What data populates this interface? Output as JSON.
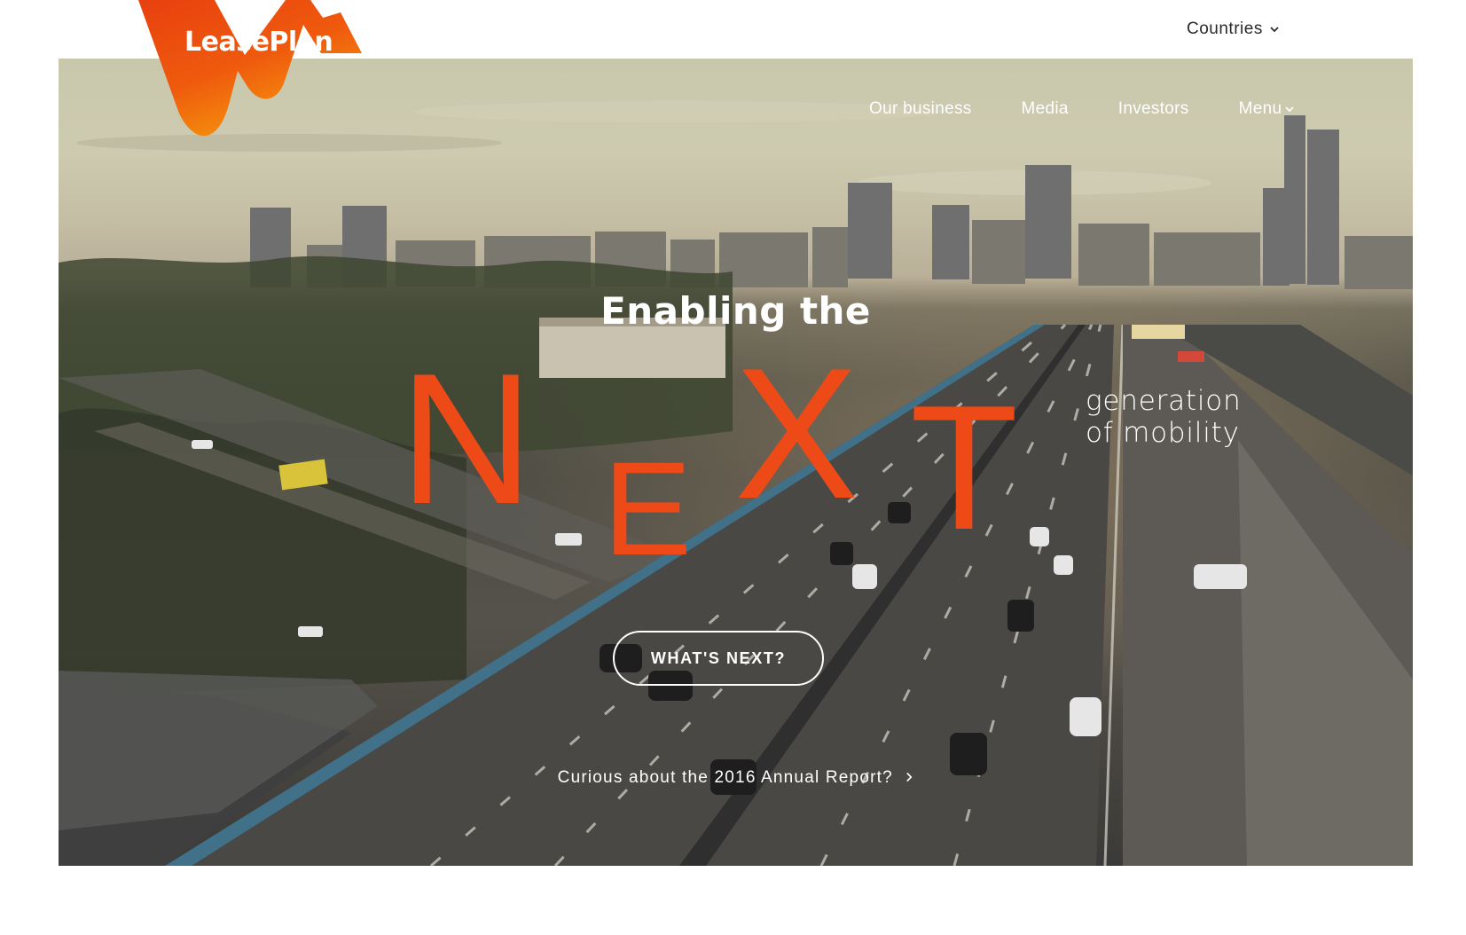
{
  "brand": {
    "name": "LeasePlan",
    "colors": {
      "primary": "#ee4a17",
      "gradient_start": "#e8400f",
      "gradient_end": "#f59a0c"
    }
  },
  "topbar": {
    "countries_label": "Countries",
    "countries_icon": "chevron-down-icon"
  },
  "nav": {
    "items": [
      {
        "label": "Our business"
      },
      {
        "label": "Media"
      },
      {
        "label": "Investors"
      },
      {
        "label": "Menu",
        "icon": "chevron-down-icon"
      }
    ]
  },
  "hero": {
    "pre_title": "Enabling the",
    "headline_letters": [
      "N",
      "E",
      "X",
      "T"
    ],
    "subtitle_line1": "generation",
    "subtitle_line2": "of mobility",
    "cta_label": "WHAT'S NEXT?",
    "report_link": "Curious about the 2016 Annual Report?",
    "report_icon": "chevron-right-icon"
  }
}
